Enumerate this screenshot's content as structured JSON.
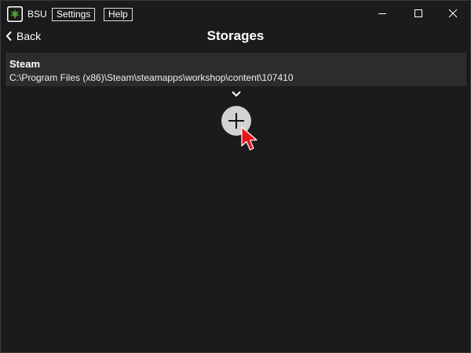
{
  "app": {
    "name": "BSU",
    "menu": {
      "settings_label": "Settings",
      "help_label": "Help"
    },
    "window_controls": [
      "minimize-icon",
      "maximize-icon",
      "close-icon"
    ]
  },
  "header": {
    "back_label": "Back",
    "title": "Storages"
  },
  "storages": [
    {
      "name": "Steam",
      "path": "C:\\Program Files (x86)\\Steam\\steamapps\\workshop\\content\\107410"
    }
  ],
  "icons": {
    "expand": "chevron-down-icon",
    "add": "plus-icon",
    "back": "chevron-left-icon",
    "cursor": "mouse-cursor-icon"
  },
  "colors": {
    "background": "#1b1b1b",
    "item_background": "#2c2c2c",
    "add_button": "#d2d2d2",
    "cursor": "#e8141c"
  }
}
